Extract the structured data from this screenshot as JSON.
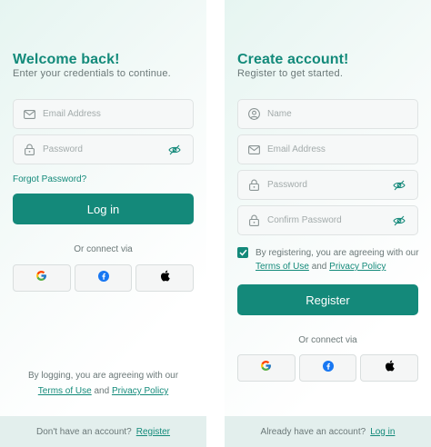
{
  "colors": {
    "accent": "#14897a",
    "footer_bg": "#e3efed"
  },
  "login": {
    "title": "Welcome back!",
    "subtitle": "Enter your credentials to continue.",
    "email_placeholder": "Email Address",
    "password_placeholder": "Password",
    "forgot_label": "Forgot Password?",
    "submit_label": "Log in",
    "connect_label": "Or connect via",
    "social": [
      {
        "name": "google",
        "icon": "google-icon"
      },
      {
        "name": "facebook",
        "icon": "facebook-icon"
      },
      {
        "name": "apple",
        "icon": "apple-icon"
      }
    ],
    "terms_prefix": "By logging, you are agreeing with our",
    "terms_link": "Terms of Use",
    "terms_and": "and",
    "privacy_link": "Privacy Policy",
    "footer_text": "Don't have an account?",
    "footer_link": "Register"
  },
  "register": {
    "title": "Create account!",
    "subtitle": "Register to get started.",
    "name_placeholder": "Name",
    "email_placeholder": "Email Address",
    "password_placeholder": "Password",
    "confirm_placeholder": "Confirm Password",
    "agree_prefix": "By registering, you are agreeing with our",
    "terms_link": "Terms of Use",
    "terms_and": "and",
    "privacy_link": "Privacy Policy",
    "agree_checked": true,
    "submit_label": "Register",
    "connect_label": "Or connect via",
    "social": [
      {
        "name": "google",
        "icon": "google-icon"
      },
      {
        "name": "facebook",
        "icon": "facebook-icon"
      },
      {
        "name": "apple",
        "icon": "apple-icon"
      }
    ],
    "footer_text": "Already have an account?",
    "footer_link": "Log in"
  }
}
